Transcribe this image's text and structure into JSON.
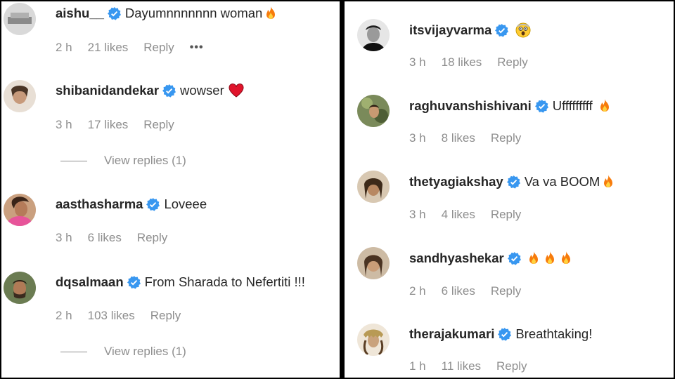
{
  "left_comments": [
    {
      "username": "aishu__",
      "text": "Dayumnnnnnnn woman",
      "emojis": [
        "fire"
      ],
      "time": "2 h",
      "likes": "21 likes",
      "reply": "Reply",
      "more": "•••"
    },
    {
      "username": "shibanidandekar",
      "text": "wowser",
      "emojis": [
        "heart"
      ],
      "time": "3 h",
      "likes": "17 likes",
      "reply": "Reply",
      "view_replies": "View replies (1)"
    },
    {
      "username": "aasthasharma",
      "text": "Loveee",
      "emojis": [],
      "time": "3 h",
      "likes": "6 likes",
      "reply": "Reply"
    },
    {
      "username": "dqsalmaan",
      "text": "From Sharada to Nefertiti !!!",
      "emojis": [],
      "time": "2 h",
      "likes": "103 likes",
      "reply": "Reply",
      "view_replies": "View replies (1)"
    }
  ],
  "right_comments": [
    {
      "username": "itsvijayvarma",
      "text": "",
      "emojis": [
        "shocked"
      ],
      "time": "3 h",
      "likes": "18 likes",
      "reply": "Reply"
    },
    {
      "username": "raghuvanshishivani",
      "text": "Ufffffffff",
      "emojis": [
        "fire"
      ],
      "time": "3 h",
      "likes": "8 likes",
      "reply": "Reply"
    },
    {
      "username": "thetyagiakshay",
      "text": "Va va BOOM",
      "emojis": [
        "fire"
      ],
      "time": "3 h",
      "likes": "4 likes",
      "reply": "Reply"
    },
    {
      "username": "sandhyashekar",
      "text": "",
      "emojis": [
        "fire",
        "fire",
        "fire"
      ],
      "time": "2 h",
      "likes": "6 likes",
      "reply": "Reply"
    },
    {
      "username": "therajakumari",
      "text": "Breathtaking!",
      "emojis": [],
      "time": "1 h",
      "likes": "11 likes",
      "reply": "Reply"
    }
  ],
  "colors": {
    "verified": "#3897f0",
    "muted_text": "#8e8e8e",
    "text": "#262626",
    "divider": "#000000"
  }
}
